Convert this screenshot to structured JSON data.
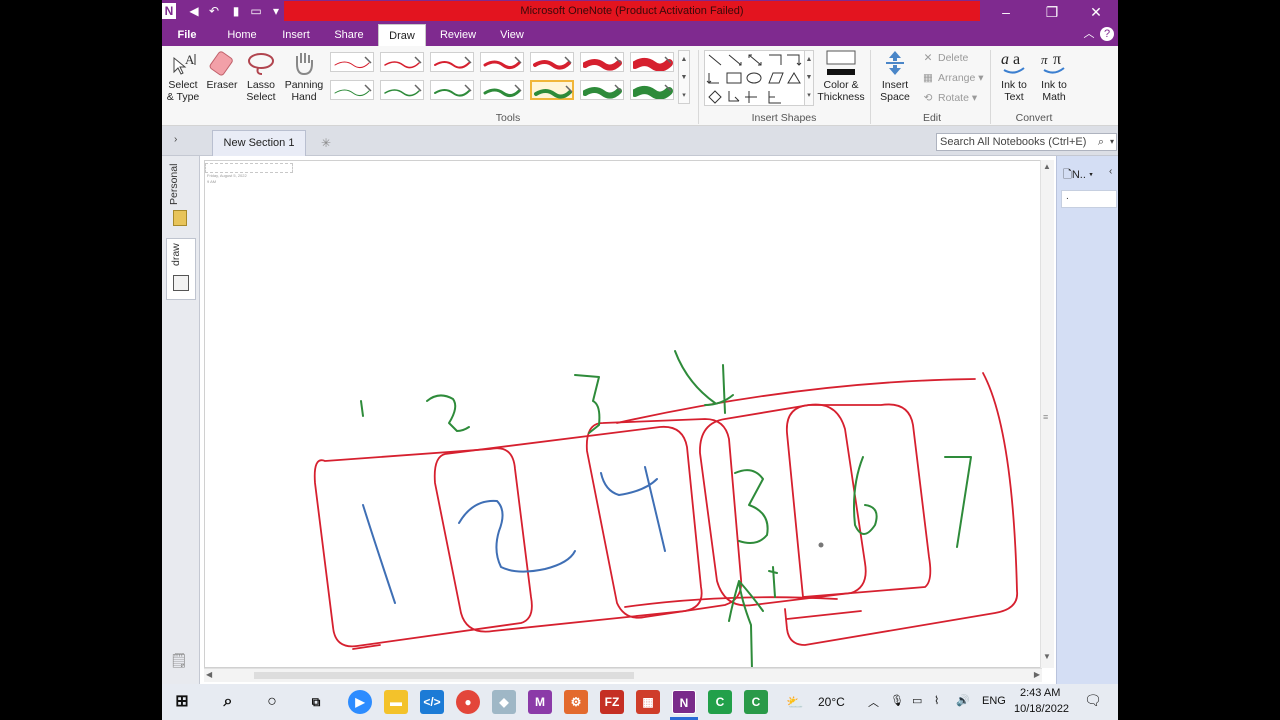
{
  "window": {
    "title": "Microsoft OneNote (Product Activation Failed)",
    "app_letter": "N",
    "controls": {
      "minimize": "–",
      "maximize": "❐",
      "close": "✕"
    }
  },
  "tabs": [
    {
      "label": "File"
    },
    {
      "label": "Home"
    },
    {
      "label": "Insert"
    },
    {
      "label": "Share"
    },
    {
      "label": "Draw"
    },
    {
      "label": "Review"
    },
    {
      "label": "View"
    }
  ],
  "ribbon": {
    "tools": {
      "select_type": "Select & Type",
      "eraser": "Eraser",
      "lasso": "Lasso Select",
      "panning": "Panning Hand",
      "group_label": "Tools"
    },
    "insert_shapes": {
      "group_label": "Insert Shapes"
    },
    "color_thickness": "Color & Thickness",
    "insert_space": "Insert Space",
    "edit": {
      "delete": "Delete",
      "arrange": "Arrange",
      "rotate": "Rotate",
      "group_label": "Edit"
    },
    "convert": {
      "ink_to_text": "Ink to Text",
      "ink_to_math": "Ink to Math",
      "group_label": "Convert"
    },
    "pen_colors": {
      "red": "#d6202f",
      "green": "#2e8b3a"
    }
  },
  "section": {
    "tab_label": "New Section 1",
    "search_placeholder": "Search All Notebooks (Ctrl+E)"
  },
  "notebooks": [
    {
      "label": "Personal"
    },
    {
      "label": "draw"
    }
  ],
  "page_pane": {
    "header": "N..",
    "item": "."
  },
  "page": {
    "date_text": "Friday, August 5, 2022",
    "time_text": "9 AM"
  },
  "ink": {
    "red": "#d6202f",
    "green": "#2e8b3a",
    "blue": "#3f6fb5"
  },
  "taskbar": {
    "weather": "20°C",
    "language": "ENG",
    "time": "2:43 AM",
    "date": "10/18/2022"
  }
}
